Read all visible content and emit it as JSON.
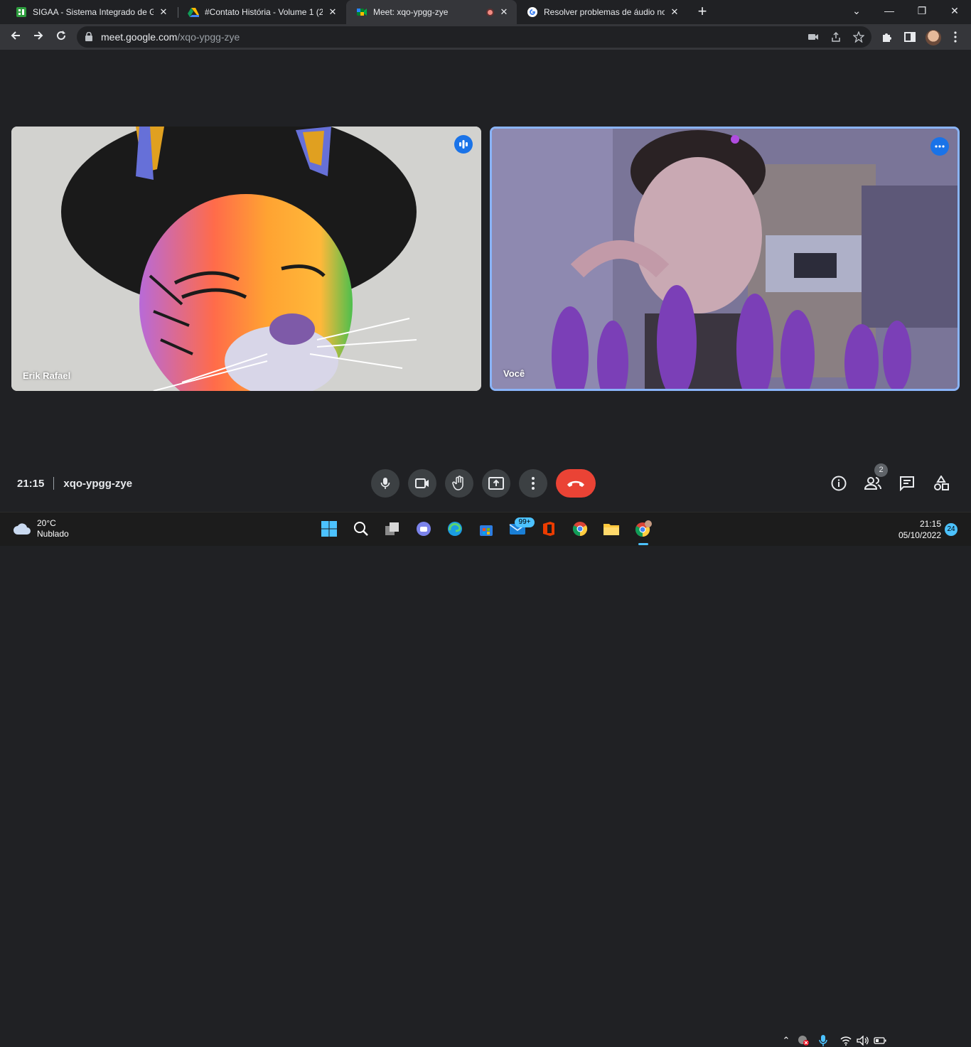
{
  "browser": {
    "tabs": [
      {
        "title": "SIGAA - Sistema Integrado de Ge",
        "favicon": "sigaa-icon"
      },
      {
        "title": "#Contato História - Volume 1 (20",
        "favicon": "google-drive-icon"
      },
      {
        "title": "Meet: xqo-ypgg-zye",
        "favicon": "google-meet-icon",
        "active": true,
        "recording": true
      },
      {
        "title": "Resolver problemas de áudio no",
        "favicon": "google-icon"
      }
    ],
    "url_domain": "meet.google.com",
    "url_path": "/xqo-ypgg-zye"
  },
  "meet": {
    "participants": [
      {
        "name": "Erik Rafael",
        "badge": "speaking-indicator-icon"
      },
      {
        "name": "Você",
        "badge": "more-options-icon"
      }
    ],
    "time": "21:15",
    "meeting_code": "xqo-ypgg-zye",
    "people_count": "2",
    "end_call_color": "#ea4335",
    "accent": "#8ab4f8"
  },
  "taskbar": {
    "weather_temp": "20°C",
    "weather_desc": "Nublado",
    "mail_badge": "99+",
    "clock_time": "21:15",
    "clock_date": "05/10/2022",
    "notifications": "24"
  }
}
